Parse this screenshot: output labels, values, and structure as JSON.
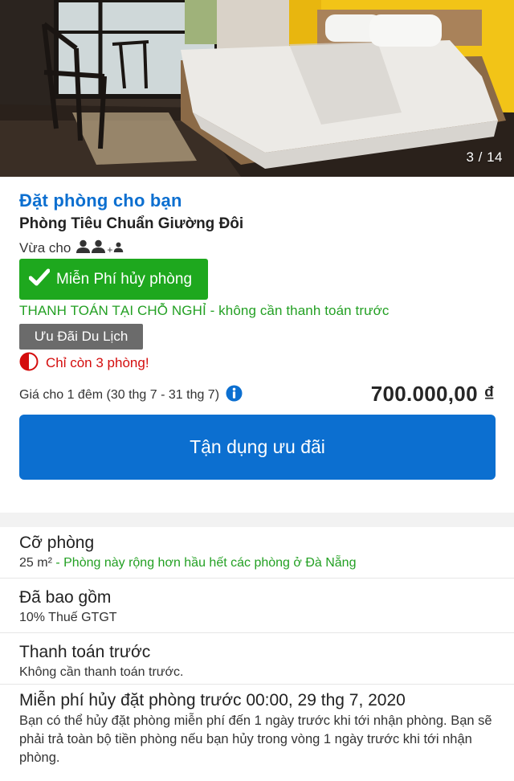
{
  "photo": {
    "counter": "3 / 14"
  },
  "room": {
    "heading": "Đặt phòng cho bạn",
    "name": "Phòng Tiêu Chuẩn Giường Đôi",
    "occupancy_label": "Vừa cho",
    "occupancy_plus": "+",
    "free_cancel": "Miễn Phí hủy phòng",
    "pay_at_property": "THANH TOÁN TẠI CHỖ NGHỈ - không cần thanh toán trước",
    "deal_badge": "Ưu Đãi Du Lịch",
    "rooms_left": "Chỉ còn 3 phòng!",
    "price_note": "Giá cho 1 đêm (30 thg 7 - 31 thg 7)",
    "price": "700.000,00 ₫",
    "cta_label": "Tận dụng ưu đãi"
  },
  "details": {
    "size": {
      "heading": "Cỡ phòng",
      "value": "25 m²",
      "separator": " - ",
      "note": "Phòng này rộng hơn hầu hết các phòng ở Đà Nẵng"
    },
    "included": {
      "heading": "Đã bao gồm",
      "value": "10% Thuế GTGT"
    },
    "prepayment": {
      "heading": "Thanh toán trước",
      "value": "Không cần thanh toán trước."
    },
    "cancellation": {
      "heading": "Miễn phí hủy đặt phòng trước 00:00, 29 thg 7, 2020",
      "value": "Bạn có thể hủy đặt phòng miễn phí đến 1 ngày trước khi tới nhận phòng. Bạn sẽ phải trả toàn bộ tiền phòng nếu bạn hủy trong vòng 1 ngày trước khi tới nhận phòng."
    }
  },
  "colors": {
    "brand_blue": "#0c6fd0",
    "success_green": "#1ea81e",
    "text_green": "#23a023",
    "alert_red": "#d40d0d",
    "deal_gray": "#6b6b6b"
  },
  "icons": {
    "occupancy": "person-icon",
    "free_cancel": "check-icon",
    "rooms_left": "half-circle-icon",
    "price_info": "info-icon"
  }
}
